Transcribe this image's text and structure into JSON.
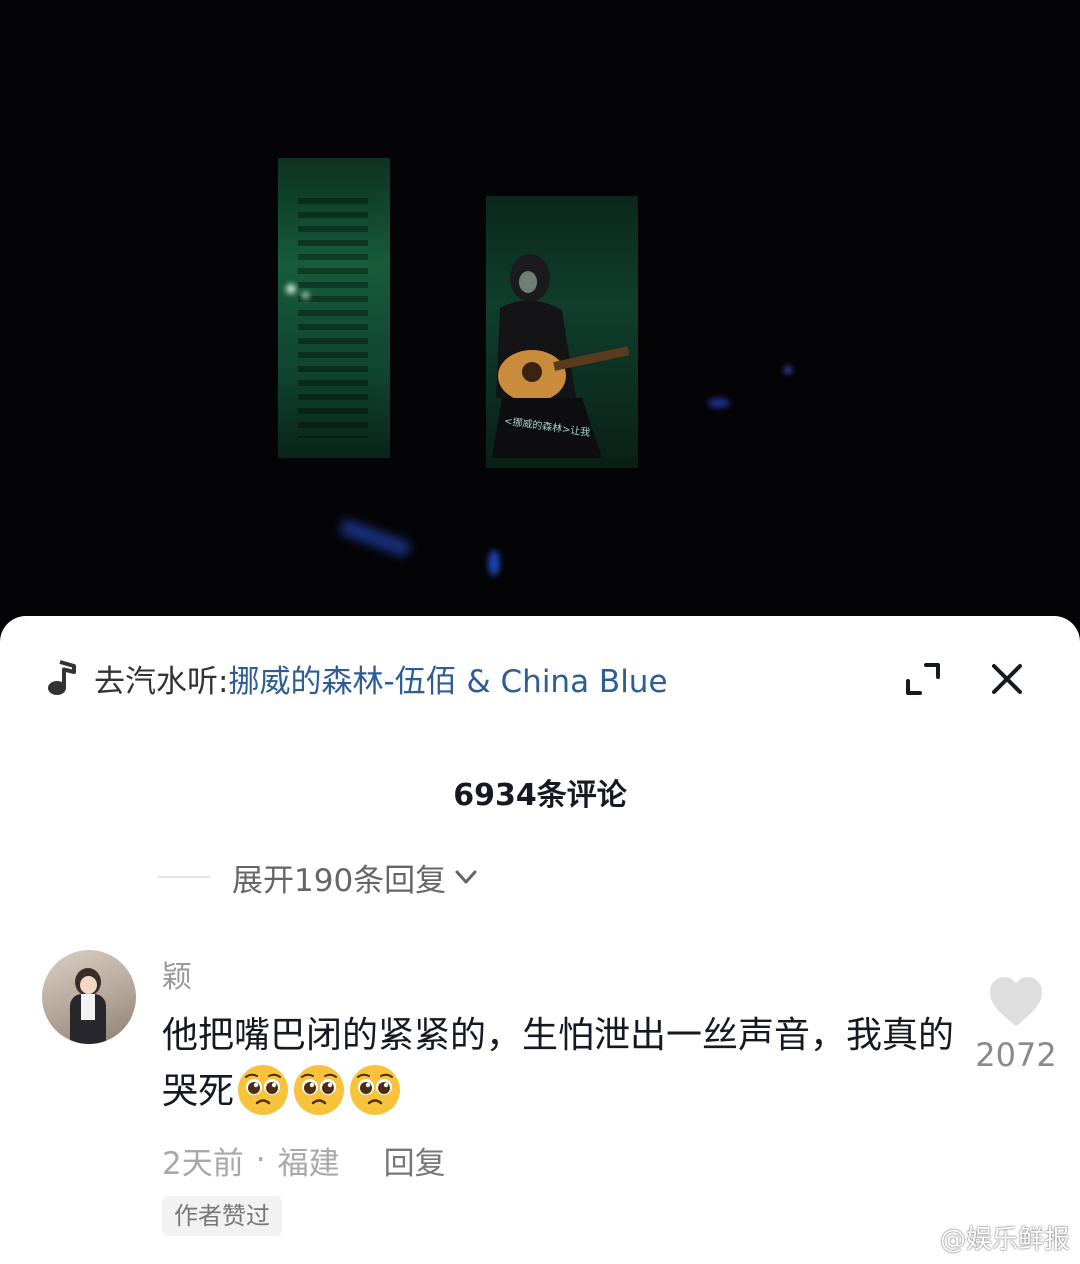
{
  "video": {
    "caption": "<挪威的森林>让我"
  },
  "music_bar": {
    "prefix": "去汽水听: ",
    "title": "挪威的森林-伍佰 & China Blue"
  },
  "comments": {
    "count_label": "6934条评论",
    "expand_label": "展开190条回复",
    "item": {
      "username": "颖",
      "text": "他把嘴巴闭的紧紧的，生怕泄出一丝声音，我真的哭死",
      "emoji_count": 3,
      "time": "2天前",
      "location": "福建",
      "separator": "·",
      "reply_label": "回复",
      "author_liked": "作者赞过",
      "like_count": "2072"
    }
  },
  "watermark": {
    "text": "@娱乐鲜报"
  },
  "colors": {
    "link": "#2d5d95",
    "sheet_bg": "#ffffff",
    "video_bg": "#040406"
  }
}
